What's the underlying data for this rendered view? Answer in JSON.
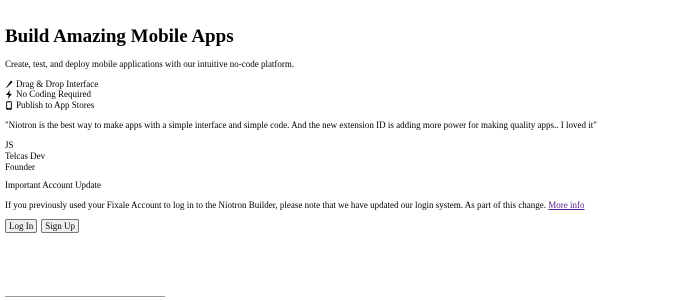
{
  "hero": {
    "title": "Build Amazing Mobile Apps",
    "subtitle": "Create, test, and deploy mobile applications with our intuitive no-code platform."
  },
  "features": [
    {
      "icon": "pencil-icon",
      "label": "Drag & Drop Interface"
    },
    {
      "icon": "lightning-icon",
      "label": "No Coding Required"
    },
    {
      "icon": "mobile-icon",
      "label": "Publish to App Stores"
    }
  ],
  "testimonial": {
    "quote": "\"Niotron is the best way to make apps with a simple interface and simple code. And the new extension ID is adding more power for making quality apps.. I loved it\"",
    "initials": "JS",
    "company": "Telcas Dev",
    "role": "Founder"
  },
  "notice": {
    "title": "Important Account Update",
    "text": "If you previously used your Fixale Account to log in to the Niotron Builder, please note that we have updated our login system. As part of this change.",
    "link": "More info"
  },
  "actions": {
    "login": "Log In",
    "signup": "Sign Up"
  }
}
